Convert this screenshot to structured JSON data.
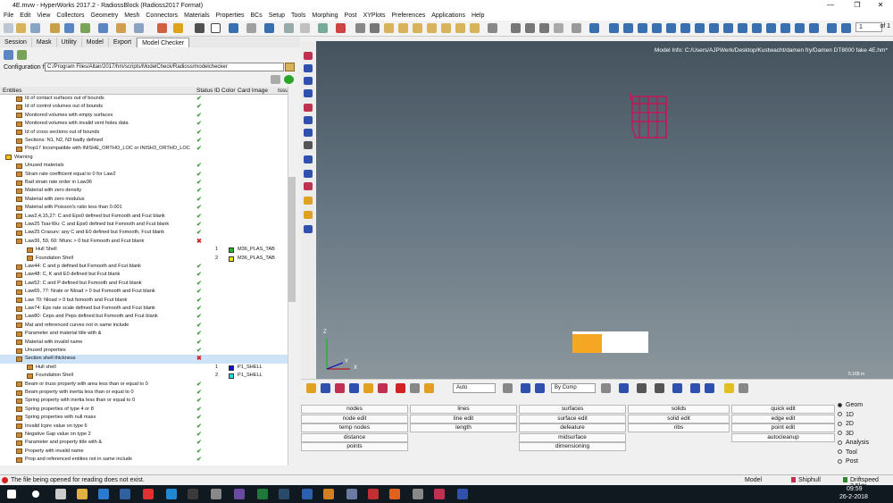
{
  "window": {
    "title": "4E.mvw - HyperWorks 2017.2 - RadiossBlock (Radioss2017 Format)",
    "min": "—",
    "max": "❐",
    "close": "✕"
  },
  "menu": [
    "File",
    "Edit",
    "View",
    "Collectors",
    "Geometry",
    "Mesh",
    "Connectors",
    "Materials",
    "Properties",
    "BCs",
    "Setup",
    "Tools",
    "Morphing",
    "Post",
    "XYPlots",
    "Preferences",
    "Applications",
    "Help"
  ],
  "toolbar": {
    "page_value": "1",
    "page_of": "of 1"
  },
  "tabs": [
    "Session",
    "Mask",
    "Utility",
    "Model",
    "Export",
    "Model Checker"
  ],
  "config": {
    "label": "Configuration file:",
    "value": "C:/Program Files/Altair/2017/hm/scripts/ModelCheck/Radioss/modelchecker"
  },
  "grid_headers": {
    "entities": "Entities",
    "status": "Status",
    "id": "ID",
    "color": "Color",
    "card": "Card Image",
    "issue": "Issu"
  },
  "rows": [
    {
      "label": "Id of contact surfaces out of bounds",
      "indent": 2,
      "status": "ok"
    },
    {
      "label": "Id of control volumes out of bounds",
      "indent": 2,
      "status": "ok"
    },
    {
      "label": "Monitored volumes with empty surfaces",
      "indent": 2,
      "status": "ok"
    },
    {
      "label": "Monitored volumes with invalid vent holes data",
      "indent": 2,
      "status": "ok"
    },
    {
      "label": "Id of cross sections out of bounds",
      "indent": 2,
      "status": "ok"
    },
    {
      "label": "Sections: N1, N2, N3 badly defined",
      "indent": 2,
      "status": "ok"
    },
    {
      "label": "Prop17 Incompatible with INISHE_ORTHO_LOC or INISH3_ORTHO_LOC",
      "indent": 2,
      "status": "ok"
    },
    {
      "label": "Warning",
      "indent": 0,
      "status": "",
      "group": true
    },
    {
      "label": "Unused materials",
      "indent": 2,
      "status": "ok"
    },
    {
      "label": "Strain rate coefficient equal to 0 for Law2",
      "indent": 2,
      "status": "ok"
    },
    {
      "label": "Bad strain rate order in Law36",
      "indent": 2,
      "status": "ok"
    },
    {
      "label": "Material with zero density",
      "indent": 2,
      "status": "ok"
    },
    {
      "label": "Material with zero modulus",
      "indent": 2,
      "status": "ok"
    },
    {
      "label": "Material with Poisson's ratio less than 0.001",
      "indent": 2,
      "status": "ok"
    },
    {
      "label": "Law2,4,15,27: C and Eps0 defined but Fsmooth and Fcut blank",
      "indent": 2,
      "status": "ok"
    },
    {
      "label": "Law25 Tsai-Wu: C and Eps0 defined but Fsmooth and Fcut blank",
      "indent": 2,
      "status": "ok"
    },
    {
      "label": "Law25 Crasurv: any C and E0 defined but Fsmooth, Fcut blank",
      "indent": 2,
      "status": "ok"
    },
    {
      "label": "Law36, 59, 60: Nfunc > 0 but Fsmooth and Fcut blank",
      "indent": 2,
      "status": "bad"
    },
    {
      "label": "Hull Shell",
      "indent": 4,
      "status": "",
      "id": "1",
      "color": "#22bb22",
      "card": "M36_PLAS_TAB"
    },
    {
      "label": "Foundation Shell",
      "indent": 4,
      "status": "",
      "id": "2",
      "color": "#e8e800",
      "card": "M36_PLAS_TAB"
    },
    {
      "label": "Law44: C and p defined but Fsmooth and Fcut blank",
      "indent": 2,
      "status": "ok"
    },
    {
      "label": "Law48: C, K and E0 defined but Fcut blank",
      "indent": 2,
      "status": "ok"
    },
    {
      "label": "Law52: C and P defined but Fsmooth and Fcut blank",
      "indent": 2,
      "status": "ok"
    },
    {
      "label": "Law65, 77: Nrate or Nload > 0 but Fsmooth and Fcut blank",
      "indent": 2,
      "status": "ok"
    },
    {
      "label": "Law 70: Nload > 0 but fsmooth and Fcut blank",
      "indent": 2,
      "status": "ok"
    },
    {
      "label": "Law74: Eps rate scale defined but Fsmooth and Fcut blank",
      "indent": 2,
      "status": "ok"
    },
    {
      "label": "Law80: Ceps and Peps defined but Fsmooth and Fcut blank",
      "indent": 2,
      "status": "ok"
    },
    {
      "label": "Mat and referenced curves not in same include",
      "indent": 2,
      "status": "ok"
    },
    {
      "label": "Parameter and material title with &",
      "indent": 2,
      "status": "ok"
    },
    {
      "label": "Material with invalid name",
      "indent": 2,
      "status": "ok"
    },
    {
      "label": "Unused properties",
      "indent": 2,
      "status": "ok"
    },
    {
      "label": "Section shell thickness",
      "indent": 2,
      "status": "bad",
      "selected": true
    },
    {
      "label": "Hull shell",
      "indent": 4,
      "status": "",
      "id": "1",
      "color": "#1010d0",
      "card": "P1_SHELL"
    },
    {
      "label": "Foundation Shell",
      "indent": 4,
      "status": "",
      "id": "2",
      "color": "#20e0e0",
      "card": "P1_SHELL"
    },
    {
      "label": "Beam or truss property with area less than or equal to 0",
      "indent": 2,
      "status": "ok"
    },
    {
      "label": "Beam property with inertia less than or equal to 0",
      "indent": 2,
      "status": "ok"
    },
    {
      "label": "Spring property with inertia less than or equal to 0",
      "indent": 2,
      "status": "ok"
    },
    {
      "label": "Spring properties of type 4 or 8",
      "indent": 2,
      "status": "ok"
    },
    {
      "label": "Spring properties with null mass",
      "indent": 2,
      "status": "ok"
    },
    {
      "label": "Invalid Icpre value on type 6",
      "indent": 2,
      "status": "ok"
    },
    {
      "label": "Negative Gap value on type 2",
      "indent": 2,
      "status": "ok"
    },
    {
      "label": "Parameter and property title with &",
      "indent": 2,
      "status": "ok"
    },
    {
      "label": "Property with invalid name",
      "indent": 2,
      "status": "ok"
    },
    {
      "label": "Prop and referenced entities not in same include",
      "indent": 2,
      "status": "ok"
    }
  ],
  "viewport": {
    "model_info": "Model Info: C:/Users/AJPWerk/Desktop/Kustwacht/damen fry/Damen DT8000 fake 4E.hm*",
    "axis_z": "Z",
    "axis_x": "X",
    "axis_y": "Y",
    "scale": "5.168 m"
  },
  "bottom_toolbar": {
    "auto": "Auto",
    "by_comp": "By Comp"
  },
  "panel_buttons": [
    [
      "nodes",
      "lines",
      "surfaces",
      "solids",
      "quick edit"
    ],
    [
      "node edit",
      "line edit",
      "surface edit",
      "solid edit",
      "edge edit"
    ],
    [
      "temp nodes",
      "length",
      "defeature",
      "ribs",
      "point edit"
    ],
    [
      "distance",
      "",
      "midsurface",
      "",
      "autocleanup"
    ],
    [
      "points",
      "",
      "dimensioning",
      "",
      ""
    ]
  ],
  "radios": [
    {
      "label": "Geom",
      "on": true
    },
    {
      "label": "1D",
      "on": false
    },
    {
      "label": "2D",
      "on": false
    },
    {
      "label": "3D",
      "on": false
    },
    {
      "label": "Analysis",
      "on": false
    },
    {
      "label": "Tool",
      "on": false
    },
    {
      "label": "Post",
      "on": false
    }
  ],
  "status": {
    "message": "The file being opened for reading does not exist.",
    "model": "Model",
    "comp": "Shiphull",
    "load": "Driftspeed 2.5kts"
  },
  "clock": {
    "time": "09:59",
    "date": "26-2-2018"
  }
}
